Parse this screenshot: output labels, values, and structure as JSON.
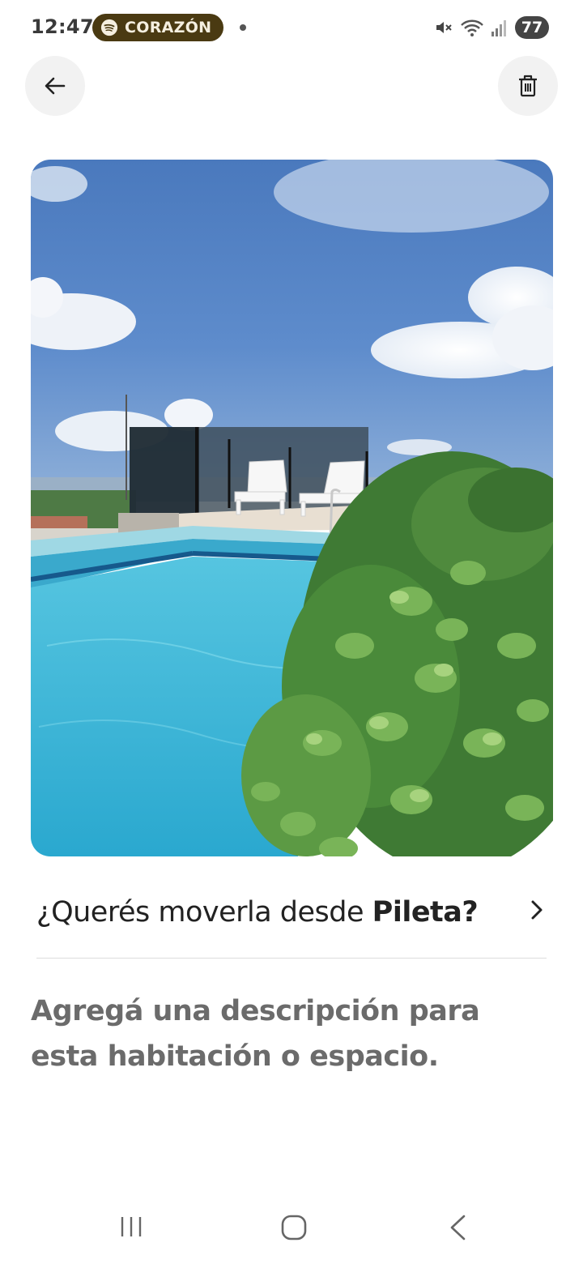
{
  "status_bar": {
    "time": "12:47",
    "media_label": "CORAZÓN",
    "battery": "77",
    "icons": [
      "spotify-icon",
      "mute-icon",
      "wifi-icon",
      "signal-icon"
    ]
  },
  "header": {
    "back_icon": "arrow-left-icon",
    "delete_icon": "trash-icon"
  },
  "photo": {
    "subject": "rooftop pool with lounge chairs and plants"
  },
  "room": {
    "question_prefix": "¿Querés moverla desde ",
    "room_name": "Pileta",
    "question_suffix": "?",
    "chevron_icon": "chevron-right-icon"
  },
  "description_placeholder": "Agregá una descripción para esta habitación o espacio.",
  "nav_bar": {
    "items": [
      "recent-apps-icon",
      "home-icon",
      "back-icon"
    ]
  },
  "colors": {
    "pill_bg": "#4a3a12",
    "button_bg": "#f2f2f2",
    "placeholder_text": "#6b6b6b"
  }
}
